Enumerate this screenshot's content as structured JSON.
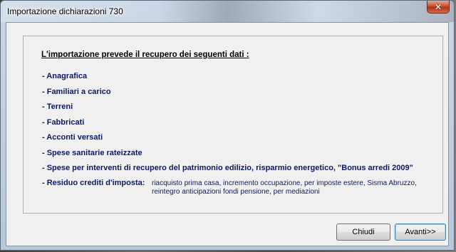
{
  "window": {
    "title": "Importazione dichiarazioni 730",
    "close_label": "✕"
  },
  "content": {
    "intro": "L'importazione prevede il recupero dei seguenti dati :",
    "items": [
      "- Anagrafica",
      "- Familiari a carico",
      "- Terreni",
      "- Fabbricati",
      "- Acconti versati",
      "- Spese sanitarie rateizzate",
      "- Spese per interventi di recupero del patrimonio edilizio, risparmio energetico, \"Bonus arredi 2009\""
    ],
    "residuo_label": "- Residuo crediti d'imposta:",
    "residuo_desc": "riacquisto prima casa, incremento occupazione, per imposte estere, Sisma Abruzzo, reintegro anticipazioni fondi pensione, per mediazioni"
  },
  "buttons": {
    "close": "Chiudi",
    "next": "Avanti>>"
  }
}
